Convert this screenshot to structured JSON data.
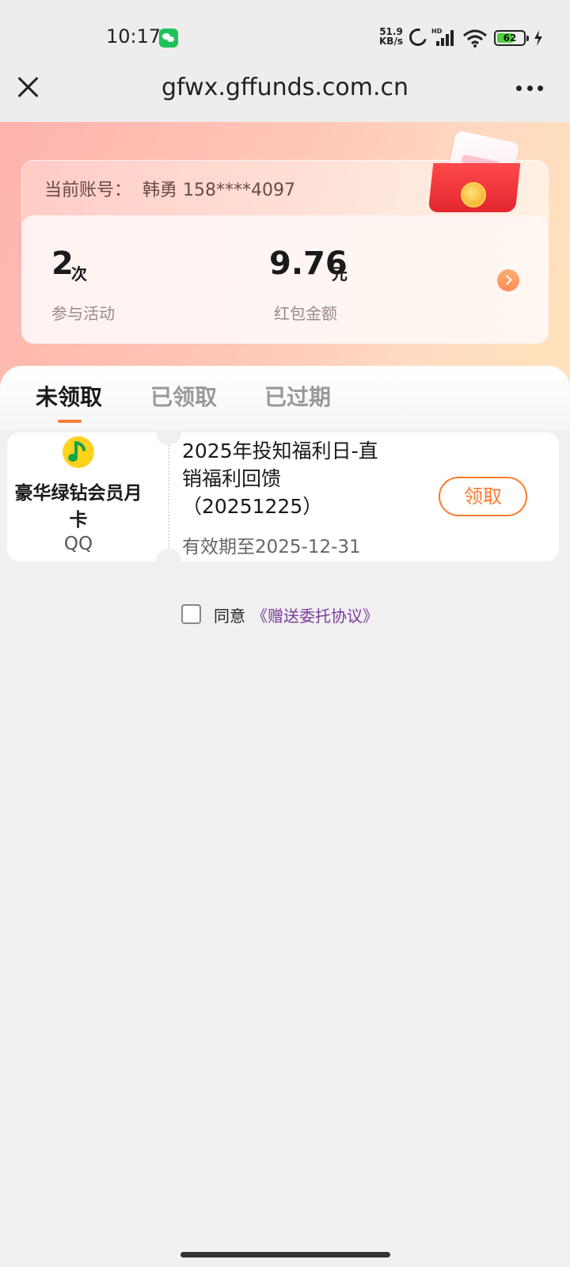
{
  "status_bar": {
    "time": "10:17",
    "net_speed_value": "51.9",
    "net_speed_unit": "KB/s",
    "network_tag": "HD",
    "battery_level": 62,
    "battery_text": "62",
    "icons": [
      "wechat-icon",
      "moon-icon",
      "signal-icon",
      "wifi-icon",
      "battery-icon",
      "charging-icon"
    ]
  },
  "browser": {
    "url": "gfwx.gffunds.com.cn",
    "close_icon": "close-icon",
    "more_icon": "more-icon"
  },
  "account": {
    "label": "当前账号：",
    "value": "韩勇 158****4097"
  },
  "stats": {
    "count_value": "2",
    "count_unit": "次",
    "count_label": "参与活动",
    "amount_value": "9.76",
    "amount_unit": "元",
    "amount_label": "红包金额"
  },
  "tabs": [
    {
      "label": "未领取",
      "active": true
    },
    {
      "label": "已领取",
      "active": false
    },
    {
      "label": "已过期",
      "active": false
    }
  ],
  "coupons": [
    {
      "product_line1": "豪华绿钻会员月",
      "product_line2": "卡",
      "brand": "QQ",
      "title_line1": "2025年投知福利日-直",
      "title_line2": "销福利回馈",
      "title_line3": "（20251225）",
      "expiry": "有效期至2025-12-31",
      "claim_label": "领取",
      "icon": "qq-music-icon"
    }
  ],
  "agreement": {
    "prefix": "同意",
    "link": "《赠送委托协议》",
    "checked": false
  },
  "colors": {
    "accent": "#ff7a2e",
    "link": "#7b3c9b",
    "hero_start": "#ffb3ad",
    "hero_end": "#ffe6ba"
  }
}
